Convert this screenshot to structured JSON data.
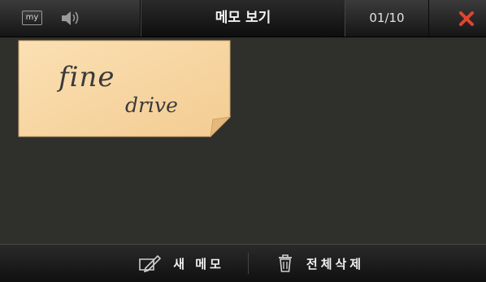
{
  "header": {
    "my_label": "my",
    "title": "메모 보기",
    "counter": "01/10"
  },
  "icons": {
    "my": "my-icon",
    "volume": "volume-icon",
    "close": "close-icon",
    "new_memo": "pen-note-icon",
    "delete_all": "trash-icon"
  },
  "memo": {
    "line1": "fine",
    "line2": "drive"
  },
  "footer": {
    "new_memo_label": "새 메모",
    "delete_all_label": "전체삭제"
  },
  "colors": {
    "close": "#e2442f",
    "memo_paper": "#f7d6a4",
    "background": "#2f2f2c"
  }
}
